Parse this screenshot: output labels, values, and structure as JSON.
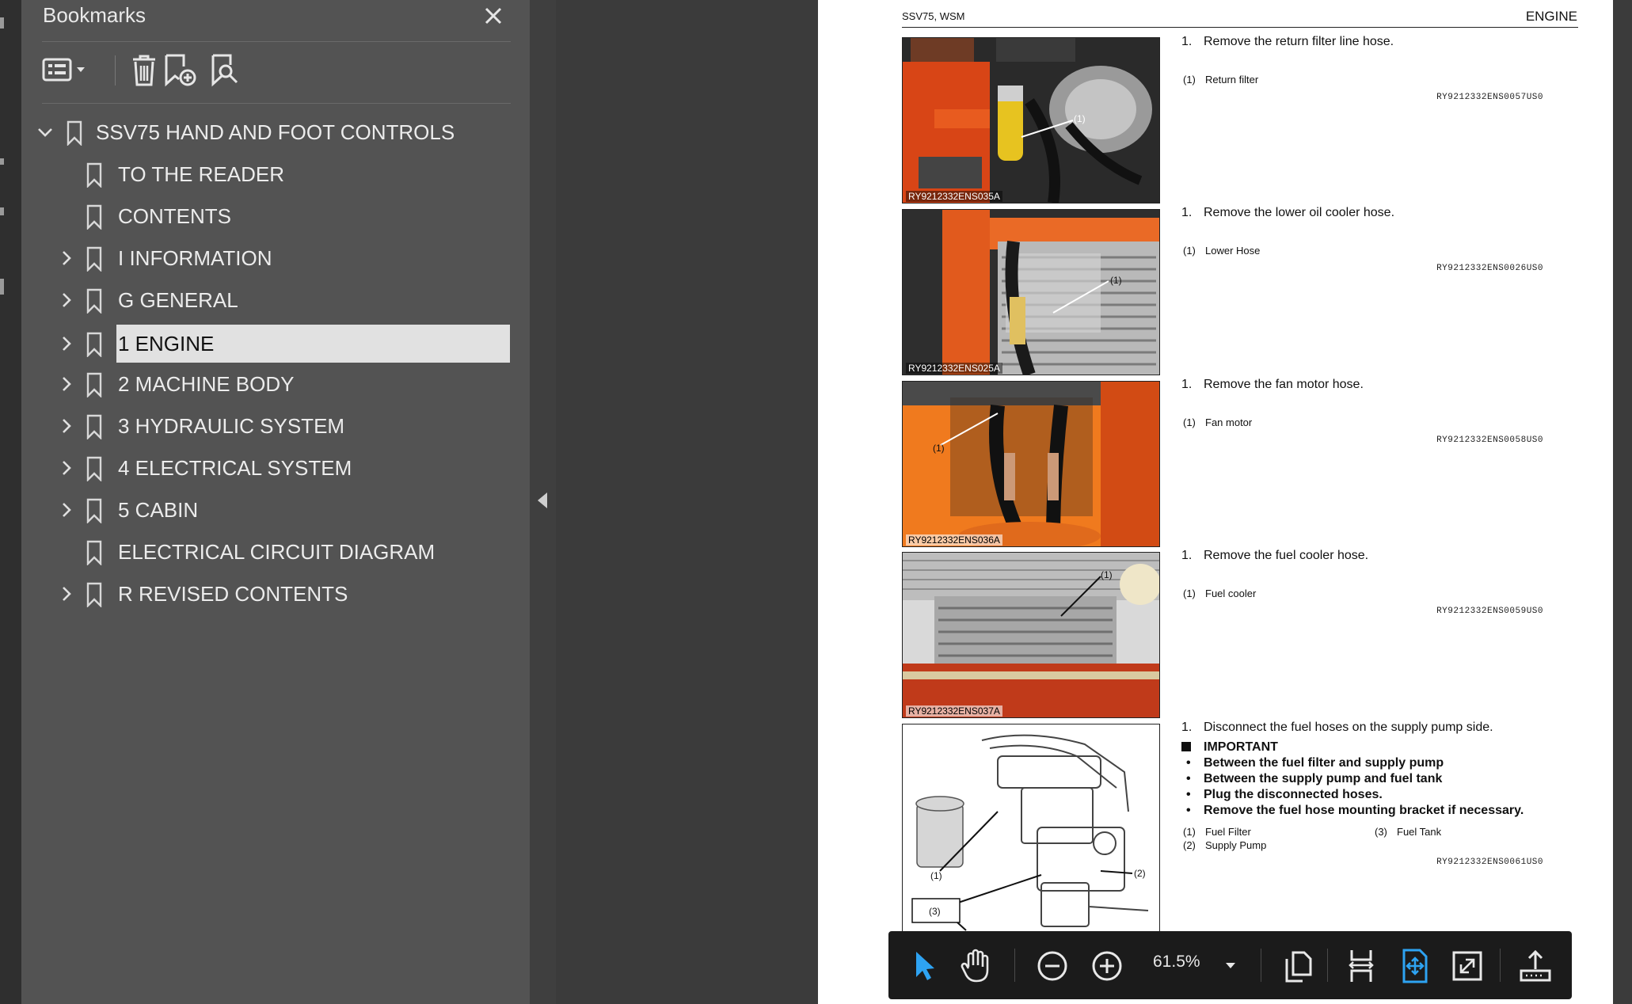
{
  "bookmarks_panel": {
    "title": "Bookmarks",
    "items": [
      {
        "label": "SSV75 HAND AND FOOT CONTROLS",
        "expanded": true
      },
      {
        "label": "TO THE READER"
      },
      {
        "label": "CONTENTS"
      },
      {
        "label": "I INFORMATION"
      },
      {
        "label": "G GENERAL"
      },
      {
        "label": "1 ENGINE",
        "selected": true
      },
      {
        "label": "2 MACHINE BODY"
      },
      {
        "label": "3 HYDRAULIC SYSTEM"
      },
      {
        "label": "4 ELECTRICAL SYSTEM"
      },
      {
        "label": "5 CABIN"
      },
      {
        "label": "ELECTRICAL CIRCUIT DIAGRAM"
      },
      {
        "label": "R REVISED CONTENTS"
      }
    ]
  },
  "page": {
    "header_left": "SSV75, WSM",
    "header_right": "ENGINE",
    "sections": [
      {
        "image_caption": "RY9212332ENS035A",
        "step_num": "1.",
        "step_text": "Remove the return filter line hose.",
        "notes": [
          {
            "n": "(1)",
            "text": "Return filter"
          }
        ],
        "ref": "RY9212332ENS0057US0",
        "callout": "(1)"
      },
      {
        "image_caption": "RY9212332ENS025A",
        "step_num": "1.",
        "step_text": "Remove the lower oil cooler hose.",
        "notes": [
          {
            "n": "(1)",
            "text": "Lower Hose"
          }
        ],
        "ref": "RY9212332ENS0026US0",
        "callout": "(1)"
      },
      {
        "image_caption": "RY9212332ENS036A",
        "step_num": "1.",
        "step_text": "Remove the fan motor hose.",
        "notes": [
          {
            "n": "(1)",
            "text": "Fan motor"
          }
        ],
        "ref": "RY9212332ENS0058US0",
        "callout": "(1)"
      },
      {
        "image_caption": "RY9212332ENS037A",
        "step_num": "1.",
        "step_text": "Remove the fuel cooler hose.",
        "notes": [
          {
            "n": "(1)",
            "text": "Fuel cooler"
          }
        ],
        "ref": "RY9212332ENS0059US0",
        "callout": "(1)"
      },
      {
        "step_num": "1.",
        "step_text": "Disconnect the fuel hoses on the supply pump side.",
        "important_title": "IMPORTANT",
        "important_items": [
          "Between the fuel filter and supply pump",
          "Between the supply pump and fuel tank",
          "Plug the disconnected hoses.",
          "Remove the fuel hose mounting bracket if necessary."
        ],
        "notes": [
          {
            "n": "(1)",
            "text": "Fuel Filter"
          },
          {
            "n": "(3)",
            "text": "Fuel Tank"
          },
          {
            "n": "(2)",
            "text": "Supply Pump"
          }
        ],
        "ref": "RY9212332ENS0061US0",
        "callouts": [
          "(1)",
          "(2)",
          "(3)"
        ]
      }
    ]
  },
  "toolbar": {
    "zoom": "61.5%",
    "icons": [
      "select-arrow-icon",
      "hand-icon",
      "zoom-out-icon",
      "zoom-in-icon",
      "page-view-icon",
      "fit-width-icon",
      "fit-page-icon",
      "full-screen-icon",
      "share-icon"
    ]
  },
  "colors": {
    "panel_bg": "#535353",
    "toolbar_bg": "#1b1b1b",
    "accent": "#2ea3f2",
    "selected_bg": "#e1e1e1"
  }
}
